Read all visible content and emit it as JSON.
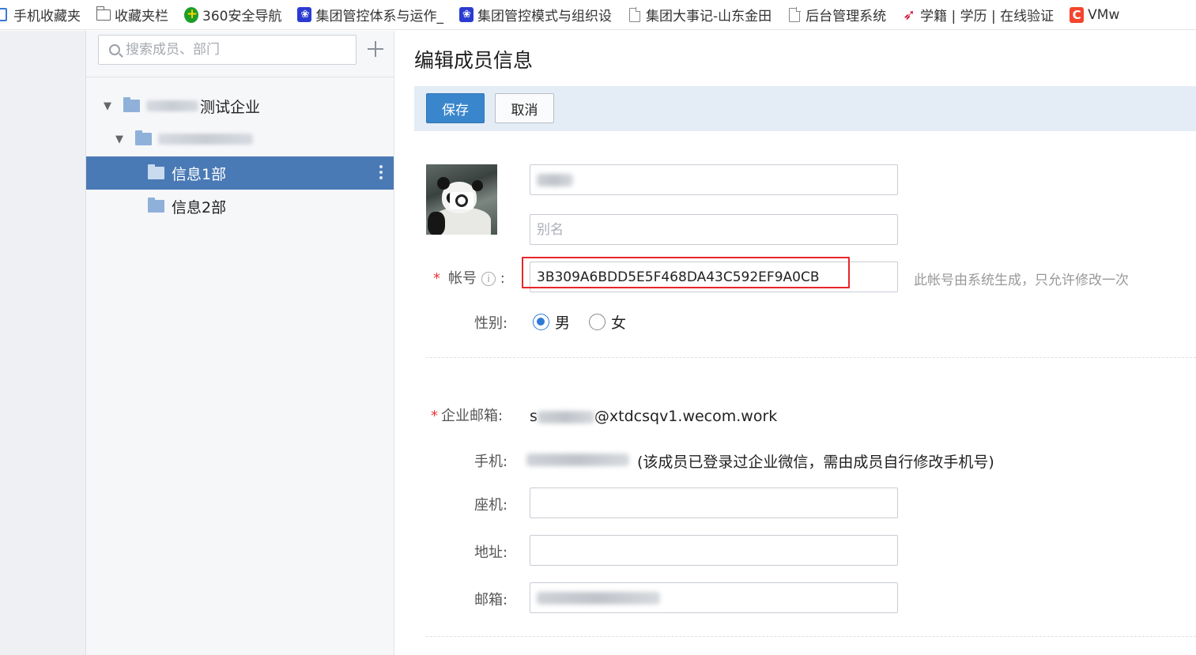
{
  "bookmarks": [
    {
      "label": "手机收藏夹",
      "icon": "phone-icon"
    },
    {
      "label": "收藏夹栏",
      "icon": "folder-icon"
    },
    {
      "label": "360安全导航",
      "icon": "360-icon"
    },
    {
      "label": "集团管控体系与运作_",
      "icon": "baidu-paw-icon"
    },
    {
      "label": "集团管控模式与组织设",
      "icon": "baidu-paw-icon"
    },
    {
      "label": "集团大事记-山东金田",
      "icon": "page-icon"
    },
    {
      "label": "后台管理系统",
      "icon": "page-icon"
    },
    {
      "label": "学籍 | 学历 | 在线验证",
      "icon": "chsi-icon"
    },
    {
      "label": "VMw",
      "icon": "c-logo-icon"
    }
  ],
  "sidebar": {
    "search_placeholder": "搜索成员、部门",
    "tree": [
      {
        "label": "测试企业",
        "caret": "▼",
        "selected": false
      },
      {
        "label": "",
        "caret": "▼",
        "selected": false
      },
      {
        "label": "信息1部",
        "caret": "",
        "selected": true
      },
      {
        "label": "信息2部",
        "caret": "",
        "selected": false
      }
    ]
  },
  "main": {
    "title": "编辑成员信息",
    "save_label": "保存",
    "cancel_label": "取消",
    "alias_placeholder": "别名",
    "account_label": "帐号",
    "account_value": "3B309A6BDD5E5F468DA43C592EF9A0CB",
    "account_hint": "此帐号由系统生成，只允许修改一次",
    "gender_label": "性别:",
    "gender_male": "男",
    "gender_female": "女",
    "corp_email_label": "企业邮箱:",
    "corp_email_suffix": "@xtdcsqv1.wecom.work",
    "corp_email_prefix": "s",
    "mobile_label": "手机:",
    "mobile_note": "(该成员已登录过企业微信，需由成员自行修改手机号)",
    "landline_label": "座机:",
    "address_label": "地址:",
    "email_label": "邮箱:"
  },
  "colors": {
    "accent": "#3a86cc",
    "selected_row": "#4a7ab5",
    "highlight_border": "#e8262b",
    "required": "#ee3333"
  }
}
